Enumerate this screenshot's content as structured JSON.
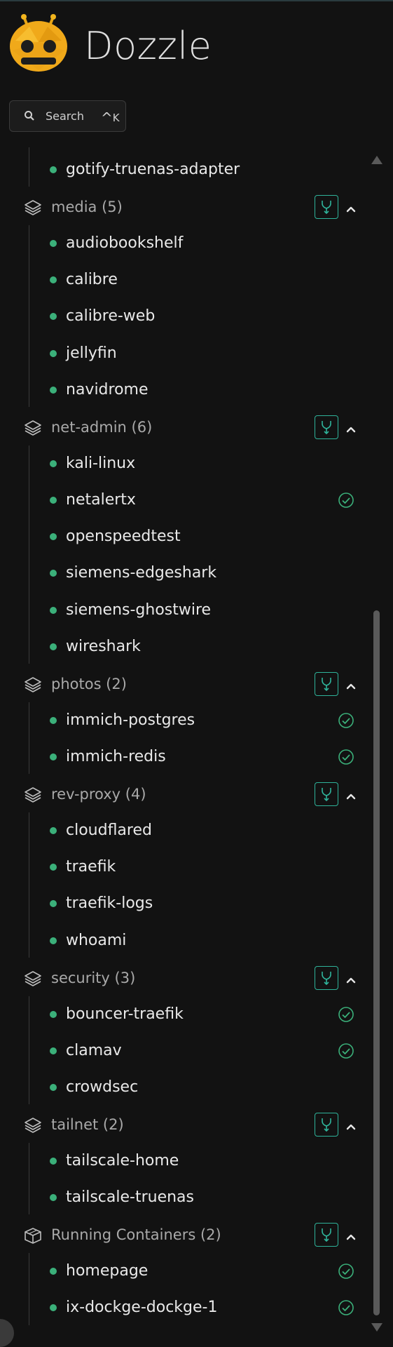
{
  "app": {
    "brand": "Dozzle"
  },
  "search": {
    "label": "Search",
    "shortcut_key": "K",
    "shortcut_modifier": "^"
  },
  "colors": {
    "accent": "#2fb39a",
    "running_dot": "#3bb07a",
    "background": "#121212"
  },
  "sidebar": {
    "top_item": {
      "name": "gotify-truenas-adapter",
      "healthy": false
    },
    "groups": [
      {
        "label": "media (5)",
        "icon": "layers-icon",
        "items": [
          {
            "name": "audiobookshelf",
            "healthy": false
          },
          {
            "name": "calibre",
            "healthy": false
          },
          {
            "name": "calibre-web",
            "healthy": false
          },
          {
            "name": "jellyfin",
            "healthy": false
          },
          {
            "name": "navidrome",
            "healthy": false
          }
        ]
      },
      {
        "label": "net-admin (6)",
        "icon": "layers-icon",
        "items": [
          {
            "name": "kali-linux",
            "healthy": false
          },
          {
            "name": "netalertx",
            "healthy": true
          },
          {
            "name": "openspeedtest",
            "healthy": false
          },
          {
            "name": "siemens-edgeshark",
            "healthy": false
          },
          {
            "name": "siemens-ghostwire",
            "healthy": false
          },
          {
            "name": "wireshark",
            "healthy": false
          }
        ]
      },
      {
        "label": "photos (2)",
        "icon": "layers-icon",
        "items": [
          {
            "name": "immich-postgres",
            "healthy": true
          },
          {
            "name": "immich-redis",
            "healthy": true
          }
        ]
      },
      {
        "label": "rev-proxy (4)",
        "icon": "layers-icon",
        "items": [
          {
            "name": "cloudflared",
            "healthy": false
          },
          {
            "name": "traefik",
            "healthy": false
          },
          {
            "name": "traefik-logs",
            "healthy": false
          },
          {
            "name": "whoami",
            "healthy": false
          }
        ]
      },
      {
        "label": "security (3)",
        "icon": "layers-icon",
        "items": [
          {
            "name": "bouncer-traefik",
            "healthy": true
          },
          {
            "name": "clamav",
            "healthy": true
          },
          {
            "name": "crowdsec",
            "healthy": false
          }
        ]
      },
      {
        "label": "tailnet (2)",
        "icon": "layers-icon",
        "items": [
          {
            "name": "tailscale-home",
            "healthy": false
          },
          {
            "name": "tailscale-truenas",
            "healthy": false
          }
        ]
      },
      {
        "label": "Running Containers (2)",
        "icon": "cube-icon",
        "items": [
          {
            "name": "homepage",
            "healthy": true
          },
          {
            "name": "ix-dockge-dockge-1",
            "healthy": true
          }
        ]
      }
    ]
  }
}
